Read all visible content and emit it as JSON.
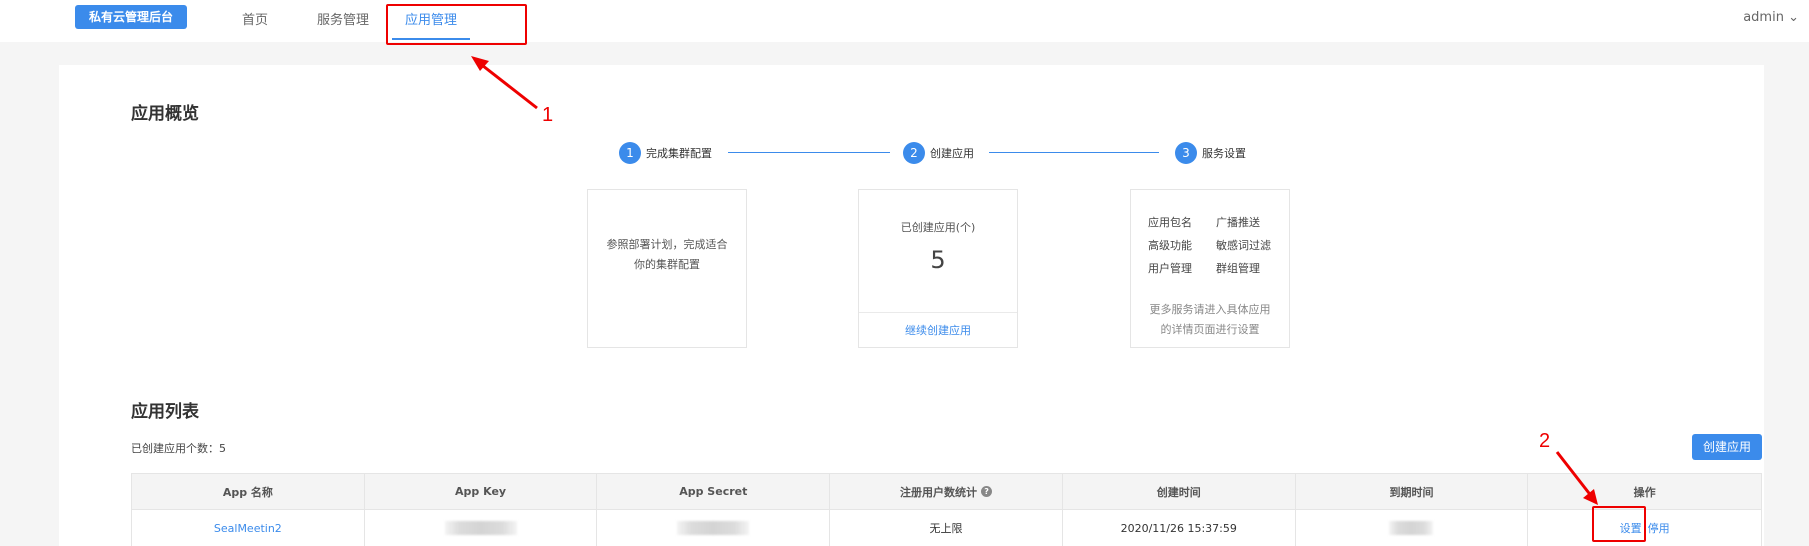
{
  "header": {
    "brand": "私有云管理后台",
    "nav": [
      {
        "label": "首页"
      },
      {
        "label": "服务管理"
      },
      {
        "label": "应用管理"
      }
    ],
    "user": "admin"
  },
  "annotations": {
    "one": "1",
    "two": "2",
    "color": "#e00000"
  },
  "overview": {
    "title": "应用概览",
    "steps": [
      {
        "num": "1",
        "label": "完成集群配置"
      },
      {
        "num": "2",
        "label": "创建应用"
      },
      {
        "num": "3",
        "label": "服务设置"
      }
    ],
    "card1": {
      "line1": "参照部署计划，完成适合",
      "line2": "你的集群配置"
    },
    "card2": {
      "label": "已创建应用(个)",
      "count": "5",
      "link": "继续创建应用"
    },
    "card3": {
      "items": [
        "应用包名",
        "广播推送",
        "高级功能",
        "敏感词过滤",
        "用户管理",
        "群组管理"
      ],
      "note1": "更多服务请进入具体应用",
      "note2": "的详情页面进行设置"
    }
  },
  "app_list": {
    "title": "应用列表",
    "count_label": "已创建应用个数：5",
    "create_button": "创建应用",
    "columns": [
      "App 名称",
      "App Key",
      "App Secret",
      "注册用户数统计",
      "创建时间",
      "到期时间",
      "操作"
    ],
    "help_icon": "?",
    "rows": [
      {
        "name": "SealMeetin2",
        "user_count": "无上限",
        "created": "2020/11/26 15:37:59",
        "action_settings": "设置",
        "action_disable": "停用"
      }
    ]
  },
  "colors": {
    "accent": "#3b8beb",
    "annotation": "#e00000"
  }
}
